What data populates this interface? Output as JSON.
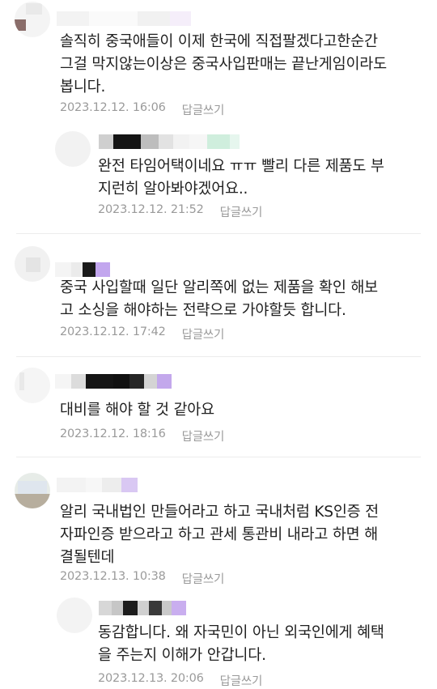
{
  "comments": [
    {
      "text": "솔직히 중국애들이 이제 한국에 직접팔겠다고한순간\n그걸 막지않는이상은 중국사입판매는 끝난게임이라도\n봅니다.",
      "date": "2023.12.12. 16:06",
      "reply_label": "답글쓰기"
    },
    {
      "text": "완전 타임어택이네요 ㅠㅠ 빨리 다른 제품도 부\n지런히 알아봐야겠어요..",
      "date": "2023.12.12. 21:52",
      "reply_label": "답글쓰기"
    },
    {
      "text": "중국 사입할때 일단 알리쪽에 없는 제품을 확인 해보\n고 소싱을 해야하는 전략으로 가야할듯 합니다.",
      "date": "2023.12.12. 17:42",
      "reply_label": "답글쓰기"
    },
    {
      "text": "대비를 해야 할 것 같아요",
      "date": "2023.12.12. 18:16",
      "reply_label": "답글쓰기"
    },
    {
      "text": "알리 국내법인 만들어라고 하고 국내처럼 KS인증 전\n자파인증 받으라고 하고 관세 통관비 내라고 하면 해\n결될텐데",
      "date": "2023.12.13. 10:38",
      "reply_label": "답글쓰기"
    },
    {
      "text": "동감합니다. 왜 자국민이 아닌 외국인에게 혜택\n을 주는지 이해가 안갑니다.",
      "date": "2023.12.13. 20:06",
      "reply_label": "답글쓰기"
    }
  ]
}
